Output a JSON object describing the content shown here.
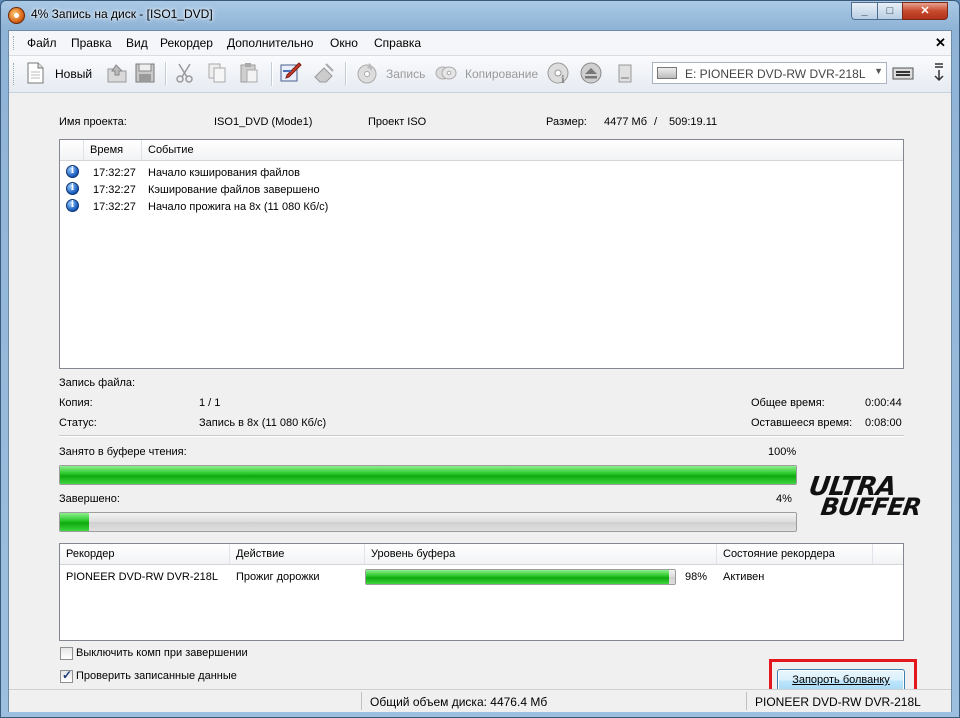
{
  "window": {
    "title": "4% Запись на диск - [ISO1_DVD]"
  },
  "menu": [
    "Файл",
    "Правка",
    "Вид",
    "Рекордер",
    "Дополнительно",
    "Окно",
    "Справка"
  ],
  "toolbar": {
    "new_label": "Новый",
    "burn_label": "Запись",
    "copy_label": "Копирование",
    "drive": "E: PIONEER DVD-RW  DVR-218L"
  },
  "project": {
    "name_label": "Имя проекта:",
    "name_value": "ISO1_DVD (Mode1)",
    "type": "Проект ISO",
    "size_label": "Размер:",
    "size_value": "4477 Мб",
    "size_sep": "/",
    "size_time": "509:19.11"
  },
  "log": {
    "columns": [
      "Время",
      "Событие"
    ],
    "rows": [
      {
        "time": "17:32:27",
        "event": "Начало кэширования файлов"
      },
      {
        "time": "17:32:27",
        "event": "Кэширование файлов завершено"
      },
      {
        "time": "17:32:27",
        "event": "Начало прожига на 8x (11 080 Кб/с)"
      }
    ]
  },
  "status": {
    "file_label": "Запись файла:",
    "copy_label": "Копия:",
    "copy_value": "1 / 1",
    "status_label": "Статус:",
    "status_value": "Запись в 8x (11 080 Кб/с)",
    "total_time_label": "Общее время:",
    "total_time_value": "0:00:44",
    "remaining_label": "Оставшееся время:",
    "remaining_value": "0:08:00"
  },
  "read_buffer": {
    "label": "Занято в буфере чтения:",
    "percent_text": "100%",
    "fraction": 1.0
  },
  "completed": {
    "label": "Завершено:",
    "percent_text": "4%",
    "fraction": 0.04
  },
  "logo": {
    "line1": "ULTRA",
    "line2": "BUFFER"
  },
  "recorders": {
    "columns": [
      "Рекордер",
      "Действие",
      "Уровень буфера",
      "Состояние рекордера"
    ],
    "rows": [
      {
        "recorder": "PIONEER DVD-RW  DVR-218L",
        "action": "Прожиг дорожки",
        "buffer_text": "98%",
        "buffer_fraction": 0.98,
        "state": "Активен"
      }
    ]
  },
  "options": {
    "shutdown_label": "Выключить комп при завершении",
    "shutdown_checked": false,
    "verify_label": "Проверить записанные данные",
    "verify_checked": true
  },
  "button": {
    "label": "Запороть болванку"
  },
  "statusbar": {
    "total_size": "Общий объем диска: 4476.4 Мб",
    "drive": "PIONEER  DVD-RW  DVR-218L"
  },
  "colors": {
    "progress_green": "#23c523",
    "highlight_red": "#e4161e",
    "titlebar_blue": "#a9c9e6"
  }
}
